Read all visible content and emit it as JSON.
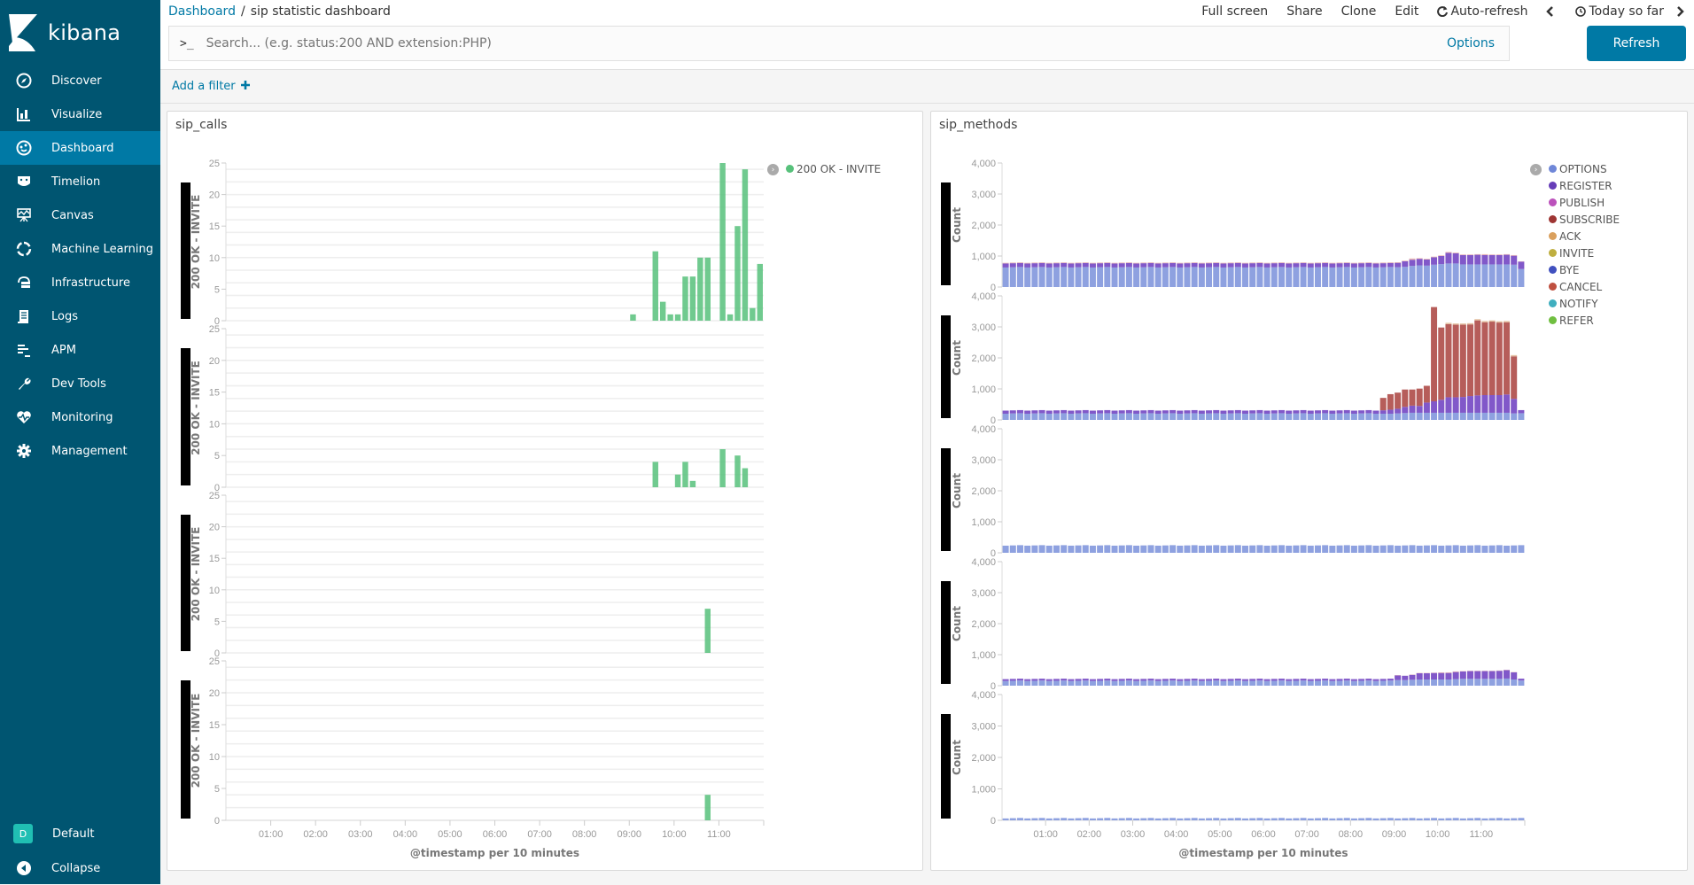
{
  "app": {
    "name": "kibana"
  },
  "sidebar": {
    "items": [
      {
        "label": "Discover",
        "icon": "compass-icon",
        "active": false
      },
      {
        "label": "Visualize",
        "icon": "bar-chart-icon",
        "active": false
      },
      {
        "label": "Dashboard",
        "icon": "dashboard-icon",
        "active": true
      },
      {
        "label": "Timelion",
        "icon": "timelion-icon",
        "active": false
      },
      {
        "label": "Canvas",
        "icon": "canvas-icon",
        "active": false
      },
      {
        "label": "Machine Learning",
        "icon": "ml-icon",
        "active": false
      },
      {
        "label": "Infrastructure",
        "icon": "infrastructure-icon",
        "active": false
      },
      {
        "label": "Logs",
        "icon": "logs-icon",
        "active": false
      },
      {
        "label": "APM",
        "icon": "apm-icon",
        "active": false
      },
      {
        "label": "Dev Tools",
        "icon": "wrench-icon",
        "active": false
      },
      {
        "label": "Monitoring",
        "icon": "heartbeat-icon",
        "active": false
      },
      {
        "label": "Management",
        "icon": "gear-icon",
        "active": false
      }
    ],
    "space": {
      "initial": "D",
      "label": "Default"
    },
    "collapse_label": "Collapse"
  },
  "header": {
    "breadcrumb_root": "Dashboard",
    "breadcrumb_sep": "/",
    "breadcrumb_current": "sip statistic dashboard",
    "menu": {
      "full_screen": "Full screen",
      "share": "Share",
      "clone": "Clone",
      "edit": "Edit",
      "auto_refresh": "Auto-refresh",
      "time_range": "Today so far"
    },
    "search": {
      "prompt": ">_",
      "placeholder": "Search... (e.g. status:200 AND extension:PHP)",
      "value": ""
    },
    "options_label": "Options",
    "refresh_label": "Refresh"
  },
  "filter_bar": {
    "add_filter_label": "Add a filter"
  },
  "panels": {
    "calls": {
      "title": "sip_calls"
    },
    "methods": {
      "title": "sip_methods"
    }
  },
  "chart_data": [
    {
      "type": "bar",
      "title": "sip_calls",
      "xlabel": "@timestamp per 10 minutes",
      "ylabel": "200 OK - INVITE",
      "x_ticks": [
        "01:00",
        "02:00",
        "03:00",
        "04:00",
        "05:00",
        "06:00",
        "07:00",
        "08:00",
        "09:00",
        "10:00",
        "11:00"
      ],
      "y_ticks": [
        0,
        5,
        10,
        15,
        20,
        25
      ],
      "ylim": [
        0,
        25
      ],
      "x_range": [
        "00:00",
        "12:00"
      ],
      "interval_minutes": 10,
      "legend": [
        {
          "name": "200 OK - INVITE",
          "color": "#57c17b"
        }
      ],
      "legend_position": "top-right",
      "grid": true,
      "subcharts": [
        {
          "points": [
            [
              "09:00",
              1
            ],
            [
              "09:30",
              11
            ],
            [
              "09:40",
              3
            ],
            [
              "09:50",
              1
            ],
            [
              "10:00",
              1
            ],
            [
              "10:10",
              7
            ],
            [
              "10:20",
              7
            ],
            [
              "10:30",
              10
            ],
            [
              "10:40",
              10
            ],
            [
              "11:00",
              25
            ],
            [
              "11:10",
              1
            ],
            [
              "11:20",
              15
            ],
            [
              "11:30",
              24
            ],
            [
              "11:40",
              2
            ],
            [
              "11:50",
              9
            ]
          ]
        },
        {
          "points": [
            [
              "09:30",
              4
            ],
            [
              "10:00",
              2
            ],
            [
              "10:10",
              4
            ],
            [
              "10:20",
              1
            ],
            [
              "11:00",
              6
            ],
            [
              "11:20",
              5
            ],
            [
              "11:30",
              3
            ]
          ]
        },
        {
          "points": [
            [
              "10:40",
              7
            ]
          ]
        },
        {
          "points": [
            [
              "10:40",
              4
            ]
          ]
        }
      ]
    },
    {
      "type": "bar",
      "stacked": true,
      "title": "sip_methods",
      "xlabel": "@timestamp per 10 minutes",
      "ylabel": "Count",
      "x_ticks": [
        "01:00",
        "02:00",
        "03:00",
        "04:00",
        "05:00",
        "06:00",
        "07:00",
        "08:00",
        "09:00",
        "10:00",
        "11:00"
      ],
      "y_ticks": [
        0,
        1000,
        2000,
        3000,
        4000
      ],
      "y_tick_labels": [
        "0",
        "1,000",
        "2,000",
        "3,000",
        "4,000"
      ],
      "ylim": [
        0,
        4000
      ],
      "x_range": [
        "00:00",
        "12:00"
      ],
      "interval_minutes": 10,
      "legend_position": "top-right",
      "grid": false,
      "legend": [
        {
          "name": "OPTIONS",
          "color": "#6f87d8"
        },
        {
          "name": "REGISTER",
          "color": "#663db8"
        },
        {
          "name": "PUBLISH",
          "color": "#bc52bc"
        },
        {
          "name": "SUBSCRIBE",
          "color": "#9e3533"
        },
        {
          "name": "ACK",
          "color": "#daa05d"
        },
        {
          "name": "INVITE",
          "color": "#bfaf40"
        },
        {
          "name": "BYE",
          "color": "#4050bf"
        },
        {
          "name": "CANCEL",
          "color": "#bf5040"
        },
        {
          "name": "NOTIFY",
          "color": "#40afbf"
        },
        {
          "name": "REFER",
          "color": "#70bf40"
        }
      ],
      "subcharts": [
        {
          "description": "OPTIONS ~630 + REGISTER ~130 baseline; rises after 09:00",
          "baseline": {
            "OPTIONS": 630,
            "REGISTER": 130,
            "other": 20
          },
          "tail": [
            [
              "09:00",
              640,
              140,
              20
            ],
            [
              "09:10",
              650,
              180,
              20
            ],
            [
              "09:20",
              680,
              200,
              40
            ],
            [
              "09:30",
              700,
              210,
              20
            ],
            [
              "09:40",
              690,
              200,
              20
            ],
            [
              "09:50",
              720,
              240,
              20
            ],
            [
              "10:00",
              740,
              260,
              20
            ],
            [
              "10:10",
              760,
              340,
              30
            ],
            [
              "10:20",
              760,
              330,
              20
            ],
            [
              "10:30",
              730,
              300,
              20
            ],
            [
              "10:40",
              730,
              300,
              20
            ],
            [
              "10:50",
              730,
              310,
              20
            ],
            [
              "11:00",
              730,
              300,
              30
            ],
            [
              "11:10",
              730,
              300,
              20
            ],
            [
              "11:20",
              730,
              300,
              20
            ],
            [
              "11:30",
              730,
              310,
              20
            ],
            [
              "11:40",
              720,
              290,
              20
            ],
            [
              "11:50",
              580,
              240,
              10
            ]
          ]
        },
        {
          "description": "OPTIONS ~200 + REGISTER ~100 baseline; CANCEL spikes after 09:00",
          "baseline": {
            "OPTIONS": 200,
            "REGISTER": 100,
            "CANCEL": 0
          },
          "tail": [
            [
              "08:40",
              200,
              110,
              400
            ],
            [
              "08:50",
              200,
              130,
              500
            ],
            [
              "09:00",
              210,
              150,
              520
            ],
            [
              "09:10",
              220,
              200,
              560
            ],
            [
              "09:20",
              230,
              230,
              520
            ],
            [
              "09:30",
              230,
              220,
              560
            ],
            [
              "09:40",
              230,
              330,
              540
            ],
            [
              "09:50",
              230,
              370,
              3040
            ],
            [
              "10:00",
              230,
              420,
              2330
            ],
            [
              "10:10",
              230,
              500,
              2360
            ],
            [
              "10:20",
              230,
              500,
              2340
            ],
            [
              "10:30",
              230,
              510,
              2330
            ],
            [
              "10:40",
              230,
              540,
              2310
            ],
            [
              "10:50",
              230,
              560,
              2420
            ],
            [
              "11:00",
              230,
              570,
              2350
            ],
            [
              "11:10",
              230,
              570,
              2370
            ],
            [
              "11:20",
              230,
              570,
              2340
            ],
            [
              "11:30",
              230,
              590,
              2330
            ],
            [
              "11:40",
              210,
              470,
              1370
            ]
          ]
        },
        {
          "description": "OPTIONS only, ~230 flat",
          "baseline": {
            "OPTIONS": 230
          }
        },
        {
          "description": "OPTIONS ~150 + REGISTER ~50 baseline; rises to ~450 after 09:00",
          "baseline": {
            "OPTIONS": 150,
            "REGISTER": 60
          },
          "tail": [
            [
              "09:00",
              180,
              150,
              10
            ],
            [
              "09:10",
              180,
              140,
              0
            ],
            [
              "09:20",
              190,
              160,
              10
            ],
            [
              "09:30",
              200,
              200,
              10
            ],
            [
              "09:40",
              200,
              200,
              10
            ],
            [
              "09:50",
              200,
              210,
              10
            ],
            [
              "10:00",
              200,
              210,
              20
            ],
            [
              "10:10",
              200,
              210,
              20
            ],
            [
              "10:20",
              210,
              230,
              20
            ],
            [
              "10:30",
              220,
              240,
              10
            ],
            [
              "10:40",
              220,
              250,
              10
            ],
            [
              "10:50",
              220,
              250,
              10
            ],
            [
              "11:00",
              220,
              250,
              10
            ],
            [
              "11:10",
              220,
              250,
              10
            ],
            [
              "11:20",
              220,
              260,
              10
            ],
            [
              "11:30",
              230,
              270,
              10
            ],
            [
              "11:40",
              200,
              230,
              10
            ]
          ]
        },
        {
          "description": "OPTIONS only, ~60 flat",
          "baseline": {
            "OPTIONS": 60
          }
        }
      ]
    }
  ]
}
